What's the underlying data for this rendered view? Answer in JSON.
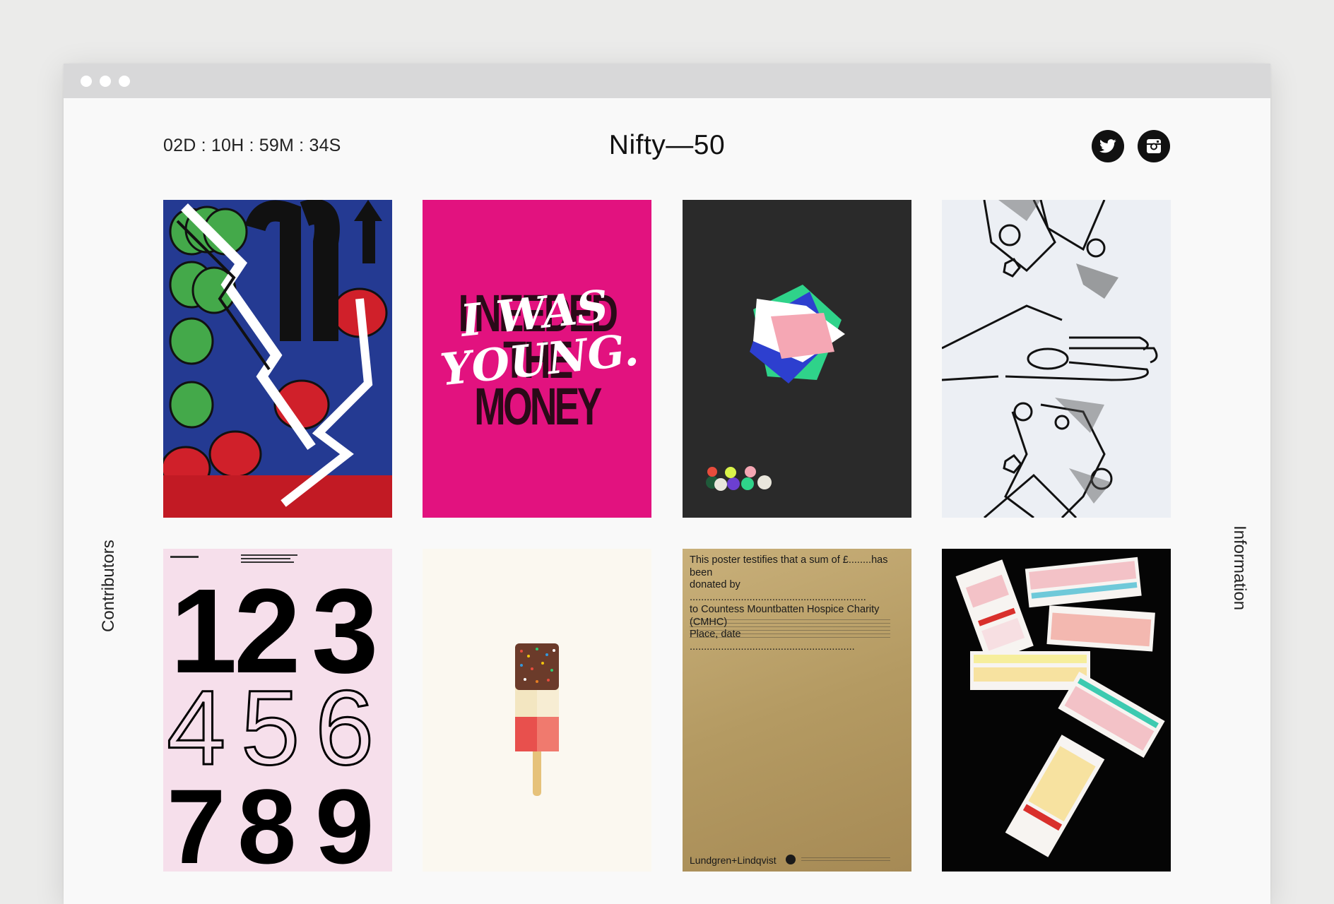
{
  "header": {
    "countdown": "02D : 10H : 59M : 34S",
    "title": "Nifty—50",
    "social": [
      {
        "name": "Twitter",
        "icon": "twitter-icon"
      },
      {
        "name": "Instagram",
        "icon": "instagram-icon"
      }
    ]
  },
  "sidebar": {
    "left_label": "Contributors",
    "right_label": "Information"
  },
  "posters": {
    "coins": {
      "icon": "coin-stacks-poster"
    },
    "young": {
      "back_lines": [
        "I NEEDED",
        "THE MONEY"
      ],
      "front_lines": [
        "I WAS",
        "YOUNG."
      ]
    },
    "shapes": {
      "icon": "overlapping-shapes-poster"
    },
    "hands": {
      "icon": "hands-drawing-poster"
    },
    "numbers": {
      "digits": [
        "1",
        "2",
        "3",
        "4",
        "5",
        "6",
        "7",
        "8",
        "9"
      ]
    },
    "icecream": {
      "icon": "ice-lolly-poster"
    },
    "gold": {
      "lines": [
        "This poster testifies that a sum of £........has been",
        "donated by ..............................................................",
        "to Countess Mountbatten Hospice Charity (CMHC)",
        "Place, date .........................................................."
      ],
      "footer": "Lundgren+Lindqvist"
    },
    "tickets": {
      "icon": "lottery-tickets-poster"
    }
  },
  "colors": {
    "page_bg": "#ebebea",
    "window_bg": "#f9f9f9",
    "titlebar": "#d8d8d9",
    "icon_bg": "#111111",
    "magenta": "#e2127f",
    "blue": "#243a92"
  }
}
